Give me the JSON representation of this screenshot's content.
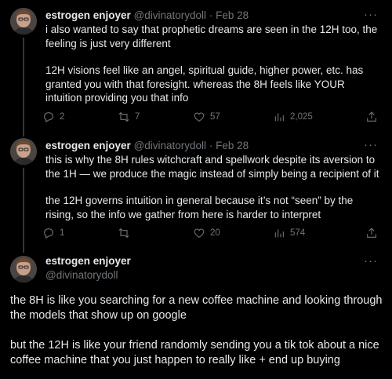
{
  "tweets": [
    {
      "name": "estrogen enjoyer",
      "handle": "@divinatorydoll",
      "separator": "·",
      "date": "Feb 28",
      "more": "···",
      "paragraphs": [
        "i also wanted to say that prophetic dreams are seen in the 12H too, the feeling is just very different",
        "12H visions feel like an angel, spiritual guide, higher power, etc. has granted you with that foresight. whereas the 8H feels like YOUR intuition providing you that info"
      ],
      "replies": "2",
      "retweets": "7",
      "likes": "57",
      "views": "2,025"
    },
    {
      "name": "estrogen enjoyer",
      "handle": "@divinatorydoll",
      "separator": "·",
      "date": "Feb 28",
      "more": "···",
      "paragraphs": [
        "this is why the 8H rules witchcraft and spellwork despite its aversion to the 1H — we produce the magic instead of simply being a recipient of it",
        "the 12H governs intuition in general because it’s not “seen” by the rising, so the info we gather from here is harder to interpret"
      ],
      "replies": "1",
      "retweets": "",
      "likes": "20",
      "views": "574"
    },
    {
      "name": "estrogen enjoyer",
      "handle": "@divinatorydoll",
      "more": "···",
      "paragraphs": [
        "the 8H is like you searching for a new coffee machine and looking through the models that show up on google",
        "but the 12H is like your friend randomly sending you a tik tok about a nice coffee machine that you just happen to really like + end up buying"
      ]
    }
  ],
  "icons": {
    "reply": "reply-icon",
    "retweet": "retweet-icon",
    "like": "heart-icon",
    "views": "views-chart-icon",
    "share": "share-icon"
  },
  "colors": {
    "background": "#000000",
    "text": "#e7e9ea",
    "muted": "#71767b",
    "thread_line": "#333639"
  }
}
